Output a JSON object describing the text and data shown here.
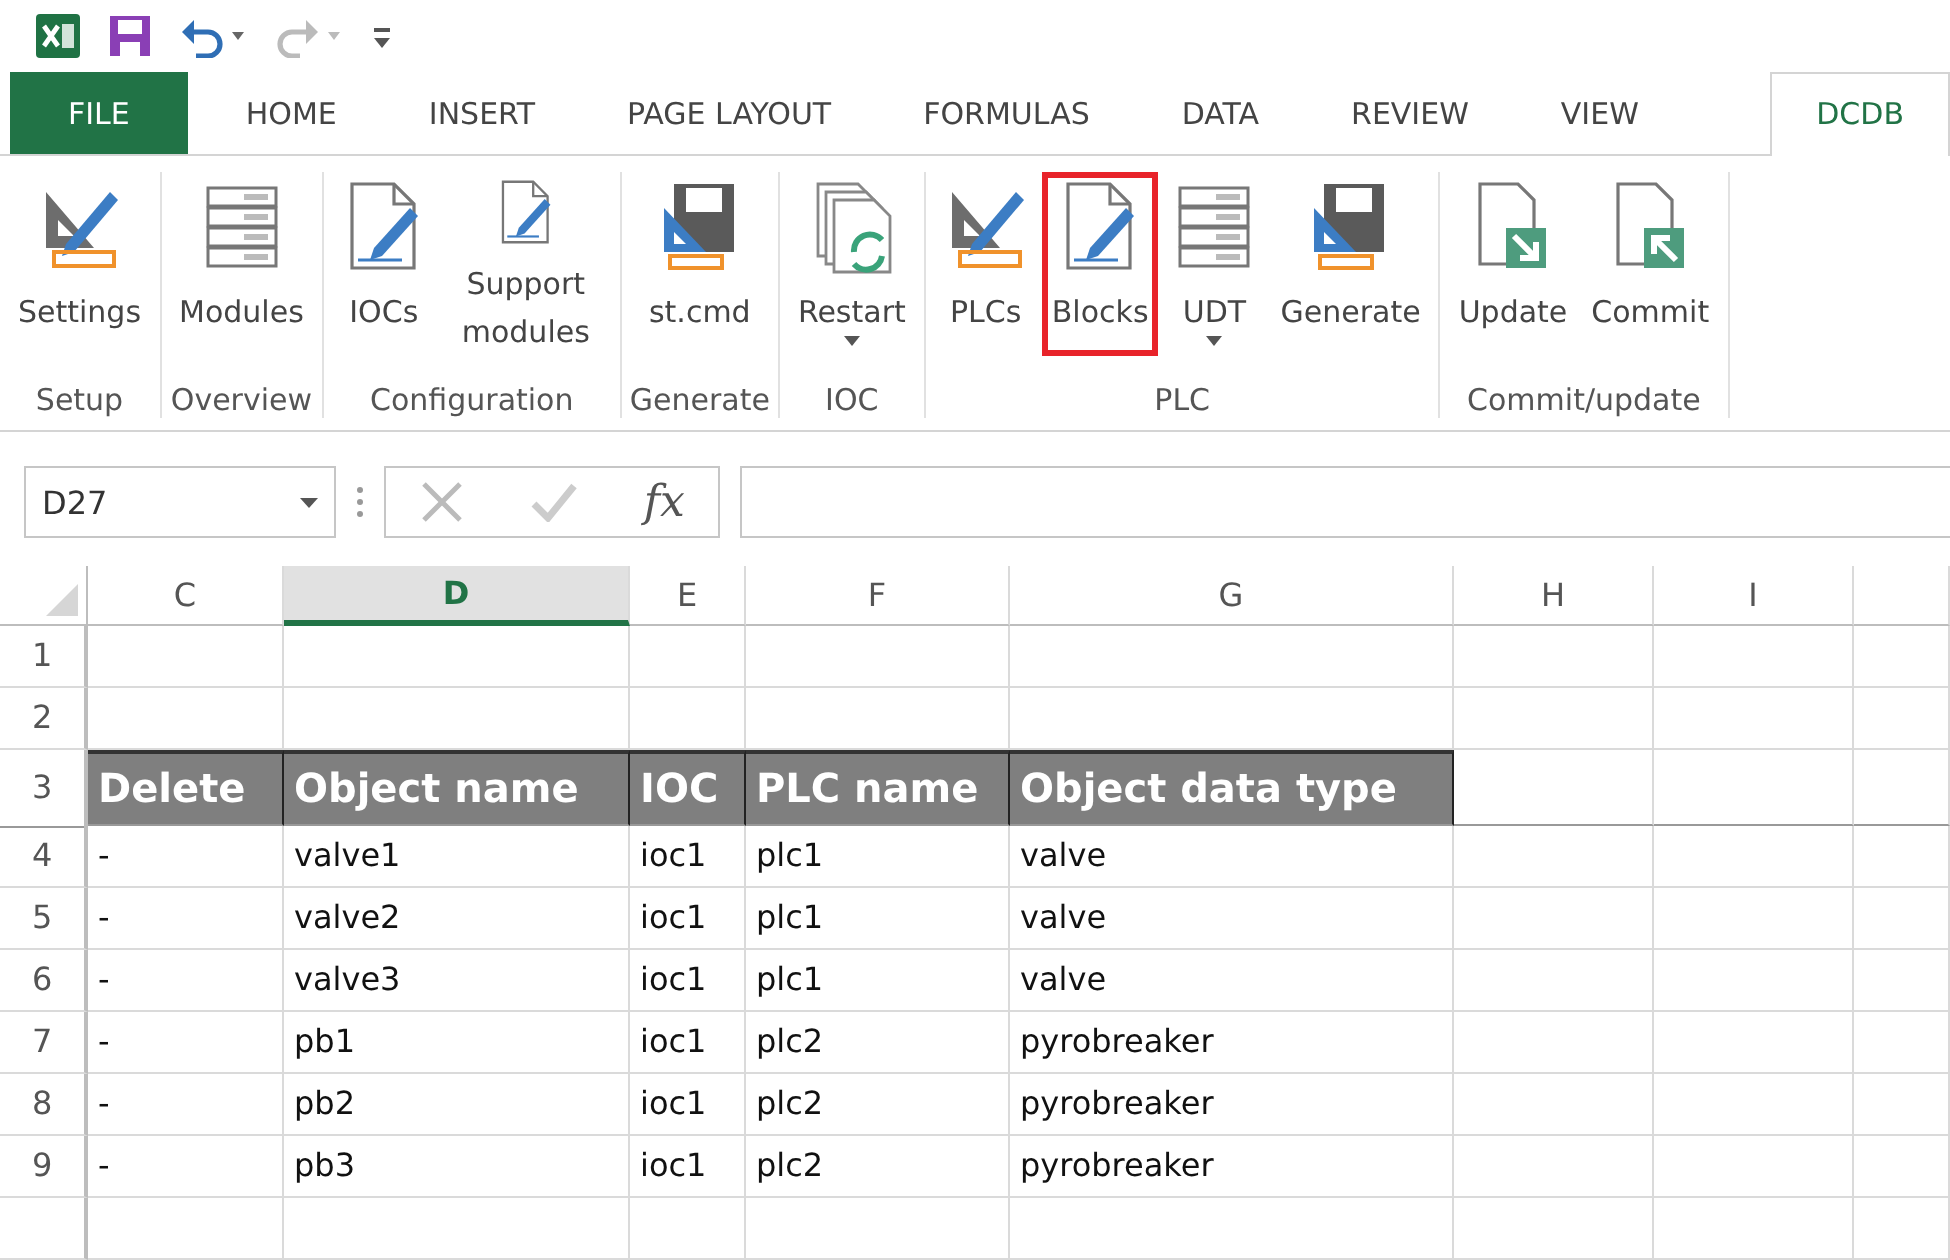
{
  "tabs": [
    {
      "label": "FILE",
      "kind": "file",
      "selected": false
    },
    {
      "label": "HOME",
      "kind": "tab",
      "selected": false
    },
    {
      "label": "INSERT",
      "kind": "tab",
      "selected": false
    },
    {
      "label": "PAGE LAYOUT",
      "kind": "tab",
      "selected": false
    },
    {
      "label": "FORMULAS",
      "kind": "tab",
      "selected": false
    },
    {
      "label": "DATA",
      "kind": "tab",
      "selected": false
    },
    {
      "label": "REVIEW",
      "kind": "tab",
      "selected": false
    },
    {
      "label": "VIEW",
      "kind": "tab",
      "selected": false
    },
    {
      "label": "DCDB",
      "kind": "tab",
      "selected": true
    }
  ],
  "ribbon_groups": [
    {
      "label": "Setup",
      "buttons": [
        {
          "label": "Settings",
          "kind": "ruler-pencil",
          "highlighted": false,
          "dropdown": false
        }
      ]
    },
    {
      "label": "Overview",
      "buttons": [
        {
          "label": "Modules",
          "kind": "rack",
          "highlighted": false,
          "dropdown": false
        }
      ]
    },
    {
      "label": "Configuration",
      "buttons": [
        {
          "label": "IOCs",
          "kind": "doc-pencil",
          "highlighted": false,
          "dropdown": false
        },
        {
          "label": "Support modules",
          "kind": "doc-pencil",
          "highlighted": false,
          "dropdown": false
        }
      ]
    },
    {
      "label": "Generate",
      "buttons": [
        {
          "label": "st.cmd",
          "kind": "disk-ruler",
          "highlighted": false,
          "dropdown": false
        }
      ]
    },
    {
      "label": "IOC",
      "buttons": [
        {
          "label": "Restart",
          "kind": "docs-refresh",
          "highlighted": false,
          "dropdown": true
        }
      ]
    },
    {
      "label": "PLC",
      "buttons": [
        {
          "label": "PLCs",
          "kind": "ruler-pencil",
          "highlighted": false,
          "dropdown": false
        },
        {
          "label": "Blocks",
          "kind": "doc-pencil",
          "highlighted": true,
          "dropdown": false
        },
        {
          "label": "UDT",
          "kind": "rack",
          "highlighted": false,
          "dropdown": true
        },
        {
          "label": "Generate",
          "kind": "disk-ruler",
          "highlighted": false,
          "dropdown": false
        }
      ]
    },
    {
      "label": "Commit/update",
      "buttons": [
        {
          "label": "Update",
          "kind": "doc-in",
          "highlighted": false,
          "dropdown": false
        },
        {
          "label": "Commit",
          "kind": "doc-out",
          "highlighted": false,
          "dropdown": false
        }
      ]
    }
  ],
  "name_box": {
    "value": "D27"
  },
  "function_label": "fx",
  "sheet": {
    "columns": [
      {
        "label": "C",
        "selected": false
      },
      {
        "label": "D",
        "selected": true
      },
      {
        "label": "E",
        "selected": false
      },
      {
        "label": "F",
        "selected": false
      },
      {
        "label": "G",
        "selected": false
      },
      {
        "label": "H",
        "selected": false
      },
      {
        "label": "I",
        "selected": false
      }
    ],
    "rows": [
      {
        "number": "1",
        "kind": "blank"
      },
      {
        "number": "2",
        "kind": "blank"
      },
      {
        "number": "3",
        "kind": "header",
        "cells": [
          "Delete",
          "Object name",
          "IOC",
          "PLC name",
          "Object data type"
        ]
      },
      {
        "number": "4",
        "kind": "data",
        "cells": [
          "-",
          "valve1",
          "ioc1",
          "plc1",
          "valve"
        ]
      },
      {
        "number": "5",
        "kind": "data",
        "cells": [
          "-",
          "valve2",
          "ioc1",
          "plc1",
          "valve"
        ]
      },
      {
        "number": "6",
        "kind": "data",
        "cells": [
          "-",
          "valve3",
          "ioc1",
          "plc1",
          "valve"
        ]
      },
      {
        "number": "7",
        "kind": "data",
        "cells": [
          "-",
          "pb1",
          "ioc1",
          "plc2",
          "pyrobreaker"
        ]
      },
      {
        "number": "8",
        "kind": "data",
        "cells": [
          "-",
          "pb2",
          "ioc1",
          "plc2",
          "pyrobreaker"
        ]
      },
      {
        "number": "9",
        "kind": "data",
        "cells": [
          "-",
          "pb3",
          "ioc1",
          "plc2",
          "pyrobreaker"
        ]
      }
    ]
  }
}
